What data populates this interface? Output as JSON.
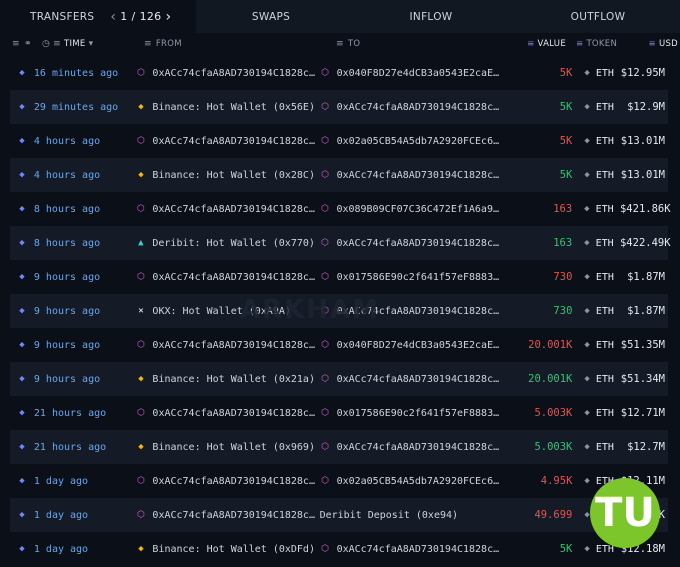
{
  "tabs": {
    "transfers": "TRANSFERS",
    "page_current": "1",
    "page_sep": "/",
    "page_total": "126",
    "swaps": "SWAPS",
    "inflow": "INFLOW",
    "outflow": "OUTFLOW"
  },
  "columns": {
    "time": "TIME",
    "from": "FROM",
    "to": "TO",
    "value": "VALUE",
    "token": "TOKEN",
    "usd": "USD"
  },
  "watermark": "ARKHAM",
  "badge": "TU",
  "colors": {
    "background": "#0b0f17",
    "row_alt": "#141b27",
    "time_link": "#5fa8ff",
    "value_out": "#e2554f",
    "value_in": "#38c172",
    "badge": "#7cc52b"
  },
  "rows": [
    {
      "time": "16 minutes ago",
      "from_icon": "contract-icon",
      "from": "0xACc74cfaA8AD730194C1828c…",
      "to_icon": "contract-icon",
      "to": "0x040F8D27e4dCB3a0543E2caE…",
      "value": "5K",
      "dir": "out",
      "token": "ETH",
      "usd": "$12.95M"
    },
    {
      "time": "29 minutes ago",
      "from_icon": "binance-icon",
      "from": "Binance: Hot Wallet (0x56E)",
      "to_icon": "contract-icon",
      "to": "0xACc74cfaA8AD730194C1828c…",
      "value": "5K",
      "dir": "in",
      "token": "ETH",
      "usd": "$12.9M"
    },
    {
      "time": "4 hours ago",
      "from_icon": "contract-icon",
      "from": "0xACc74cfaA8AD730194C1828c…",
      "to_icon": "contract-icon",
      "to": "0x02a05CB54A5db7A2920FCEc6…",
      "value": "5K",
      "dir": "out",
      "token": "ETH",
      "usd": "$13.01M"
    },
    {
      "time": "4 hours ago",
      "from_icon": "binance-icon",
      "from": "Binance: Hot Wallet (0x28C)",
      "to_icon": "contract-icon",
      "to": "0xACc74cfaA8AD730194C1828c…",
      "value": "5K",
      "dir": "in",
      "token": "ETH",
      "usd": "$13.01M"
    },
    {
      "time": "8 hours ago",
      "from_icon": "contract-icon",
      "from": "0xACc74cfaA8AD730194C1828c…",
      "to_icon": "contract-icon",
      "to": "0x089B09CF07C36C472Ef1A6a9…",
      "value": "163",
      "dir": "out",
      "token": "ETH",
      "usd": "$421.86K"
    },
    {
      "time": "8 hours ago",
      "from_icon": "deribit-icon",
      "from": "Deribit: Hot Wallet (0x770)",
      "to_icon": "contract-icon",
      "to": "0xACc74cfaA8AD730194C1828c…",
      "value": "163",
      "dir": "in",
      "token": "ETH",
      "usd": "$422.49K"
    },
    {
      "time": "9 hours ago",
      "from_icon": "contract-icon",
      "from": "0xACc74cfaA8AD730194C1828c…",
      "to_icon": "contract-icon",
      "to": "0x017586E90c2f641f57eF8883…",
      "value": "730",
      "dir": "out",
      "token": "ETH",
      "usd": "$1.87M"
    },
    {
      "time": "9 hours ago",
      "from_icon": "okx-icon",
      "from": "OKX: Hot Wallet (0xA9A)",
      "to_icon": "contract-icon",
      "to": "0xACc74cfaA8AD730194C1828c…",
      "value": "730",
      "dir": "in",
      "token": "ETH",
      "usd": "$1.87M"
    },
    {
      "time": "9 hours ago",
      "from_icon": "contract-icon",
      "from": "0xACc74cfaA8AD730194C1828c…",
      "to_icon": "contract-icon",
      "to": "0x040F8D27e4dCB3a0543E2caE…",
      "value": "20.001K",
      "dir": "out",
      "token": "ETH",
      "usd": "$51.35M"
    },
    {
      "time": "9 hours ago",
      "from_icon": "binance-icon",
      "from": "Binance: Hot Wallet (0x21a)",
      "to_icon": "contract-icon",
      "to": "0xACc74cfaA8AD730194C1828c…",
      "value": "20.001K",
      "dir": "in",
      "token": "ETH",
      "usd": "$51.34M"
    },
    {
      "time": "21 hours ago",
      "from_icon": "contract-icon",
      "from": "0xACc74cfaA8AD730194C1828c…",
      "to_icon": "contract-icon",
      "to": "0x017586E90c2f641f57eF8883…",
      "value": "5.003K",
      "dir": "out",
      "token": "ETH",
      "usd": "$12.71M"
    },
    {
      "time": "21 hours ago",
      "from_icon": "binance-icon",
      "from": "Binance: Hot Wallet (0x969)",
      "to_icon": "contract-icon",
      "to": "0xACc74cfaA8AD730194C1828c…",
      "value": "5.003K",
      "dir": "in",
      "token": "ETH",
      "usd": "$12.7M"
    },
    {
      "time": "1 day ago",
      "from_icon": "contract-icon",
      "from": "0xACc74cfaA8AD730194C1828c…",
      "to_icon": "contract-icon",
      "to": "0x02a05CB54A5db7A2920FCEc6…",
      "value": "4.95K",
      "dir": "out",
      "token": "ETH",
      "usd": "$12.11M"
    },
    {
      "time": "1 day ago",
      "from_icon": "contract-icon",
      "from": "0xACc74cfaA8AD730194C1828c…",
      "to_icon": "none",
      "to": "Deribit Deposit (0xe94)",
      "value": "49.699",
      "dir": "out",
      "token": "ETH",
      "usd": "$121.5K"
    },
    {
      "time": "1 day ago",
      "from_icon": "binance-icon",
      "from": "Binance: Hot Wallet (0xDFd)",
      "to_icon": "contract-icon",
      "to": "0xACc74cfaA8AD730194C1828c…",
      "value": "5K",
      "dir": "in",
      "token": "ETH",
      "usd": "$12.18M"
    }
  ]
}
